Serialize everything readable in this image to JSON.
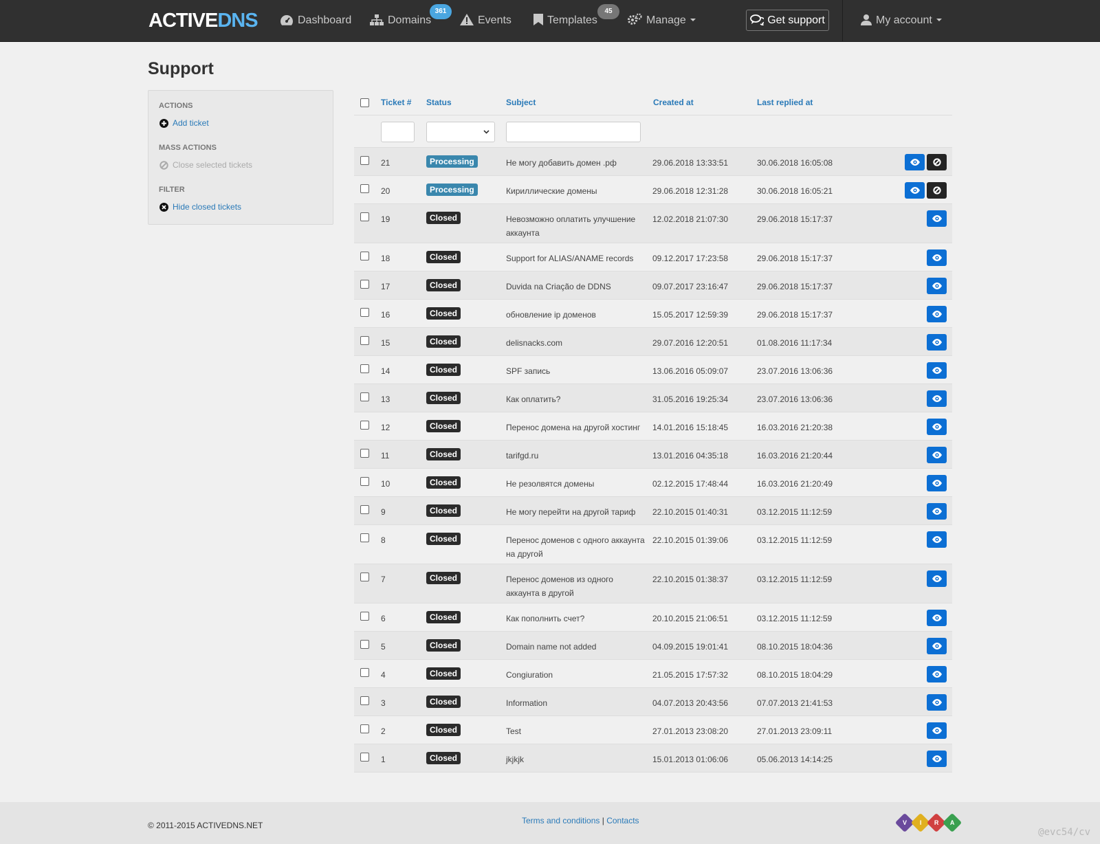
{
  "nav": {
    "brand_part1": "ACTIVE",
    "brand_part2": "DNS",
    "dashboard": "Dashboard",
    "domains": "Domains",
    "domains_count": "361",
    "events": "Events",
    "templates": "Templates",
    "templates_count": "45",
    "manage": "Manage",
    "get_support": "Get support",
    "my_account": "My account",
    "colors": {
      "bar": "#303030",
      "brand_accent": "#5ab4f0",
      "domains_badge": "#4aa6e0",
      "templates_badge": "#777777"
    }
  },
  "page": {
    "title": "Support"
  },
  "sidebar": {
    "actions_heading": "ACTIONS",
    "add_ticket": "Add ticket",
    "mass_actions_heading": "MASS ACTIONS",
    "close_selected": "Close selected tickets",
    "filter_heading": "FILTER",
    "hide_closed": "Hide closed tickets"
  },
  "table": {
    "headers": {
      "ticket": "Ticket #",
      "status": "Status",
      "subject": "Subject",
      "created": "Created at",
      "replied": "Last replied at"
    },
    "status_colors": {
      "Processing": "#3a87ad",
      "Closed": "#2b2b2b"
    },
    "rows": [
      {
        "id": "21",
        "status": "Processing",
        "subject": "Не могу добавить домен .рф",
        "created": "29.06.2018 13:33:51",
        "replied": "30.06.2018 16:05:08",
        "can_close": true
      },
      {
        "id": "20",
        "status": "Processing",
        "subject": "Кириллические домены",
        "created": "29.06.2018 12:31:28",
        "replied": "30.06.2018 16:05:21",
        "can_close": true
      },
      {
        "id": "19",
        "status": "Closed",
        "subject": "Невозможно оплатить улучшение аккаунта",
        "created": "12.02.2018 21:07:30",
        "replied": "29.06.2018 15:17:37",
        "can_close": false,
        "tall": true
      },
      {
        "id": "18",
        "status": "Closed",
        "subject": "Support for ALIAS/ANAME records",
        "created": "09.12.2017 17:23:58",
        "replied": "29.06.2018 15:17:37",
        "can_close": false
      },
      {
        "id": "17",
        "status": "Closed",
        "subject": "Duvida na Criação de DDNS",
        "created": "09.07.2017 23:16:47",
        "replied": "29.06.2018 15:17:37",
        "can_close": false
      },
      {
        "id": "16",
        "status": "Closed",
        "subject": "обновление ip доменов",
        "created": "15.05.2017 12:59:39",
        "replied": "29.06.2018 15:17:37",
        "can_close": false
      },
      {
        "id": "15",
        "status": "Closed",
        "subject": "delisnacks.com",
        "created": "29.07.2016 12:20:51",
        "replied": "01.08.2016 11:17:34",
        "can_close": false
      },
      {
        "id": "14",
        "status": "Closed",
        "subject": "SPF запись",
        "created": "13.06.2016 05:09:07",
        "replied": "23.07.2016 13:06:36",
        "can_close": false
      },
      {
        "id": "13",
        "status": "Closed",
        "subject": "Как оплатить?",
        "created": "31.05.2016 19:25:34",
        "replied": "23.07.2016 13:06:36",
        "can_close": false
      },
      {
        "id": "12",
        "status": "Closed",
        "subject": "Перенос домена на другой хостинг",
        "created": "14.01.2016 15:18:45",
        "replied": "16.03.2016 21:20:38",
        "can_close": false
      },
      {
        "id": "11",
        "status": "Closed",
        "subject": "tarifgd.ru",
        "created": "13.01.2016 04:35:18",
        "replied": "16.03.2016 21:20:44",
        "can_close": false
      },
      {
        "id": "10",
        "status": "Closed",
        "subject": "Не резолвятся домены",
        "created": "02.12.2015 17:48:44",
        "replied": "16.03.2016 21:20:49",
        "can_close": false
      },
      {
        "id": "9",
        "status": "Closed",
        "subject": "Не могу перейти на другой тариф",
        "created": "22.10.2015 01:40:31",
        "replied": "03.12.2015 11:12:59",
        "can_close": false
      },
      {
        "id": "8",
        "status": "Closed",
        "subject": "Перенос доменов с одного аккаунта на другой",
        "created": "22.10.2015 01:39:06",
        "replied": "03.12.2015 11:12:59",
        "can_close": false,
        "tall": true
      },
      {
        "id": "7",
        "status": "Closed",
        "subject": "Перенос доменов из одного аккаунта в другой",
        "created": "22.10.2015 01:38:37",
        "replied": "03.12.2015 11:12:59",
        "can_close": false,
        "tall": true
      },
      {
        "id": "6",
        "status": "Closed",
        "subject": "Как пополнить счет?",
        "created": "20.10.2015 21:06:51",
        "replied": "03.12.2015 11:12:59",
        "can_close": false
      },
      {
        "id": "5",
        "status": "Closed",
        "subject": "Domain name not added",
        "created": "04.09.2015 19:01:41",
        "replied": "08.10.2015 18:04:36",
        "can_close": false
      },
      {
        "id": "4",
        "status": "Closed",
        "subject": "Congiuration",
        "created": "21.05.2015 17:57:32",
        "replied": "08.10.2015 18:04:29",
        "can_close": false
      },
      {
        "id": "3",
        "status": "Closed",
        "subject": "Information",
        "created": "04.07.2013 20:43:56",
        "replied": "07.07.2013 21:41:53",
        "can_close": false
      },
      {
        "id": "2",
        "status": "Closed",
        "subject": "Test",
        "created": "27.01.2013 23:08:20",
        "replied": "27.01.2013 23:09:11",
        "can_close": false
      },
      {
        "id": "1",
        "status": "Closed",
        "subject": "jkjkjk",
        "created": "15.01.2013 01:06:06",
        "replied": "05.06.2013 14:14:25",
        "can_close": false
      }
    ]
  },
  "footer": {
    "copyright": "© 2011-2015 ACTIVEDNS.NET",
    "terms": "Terms and conditions",
    "separator": "|",
    "contacts": "Contacts",
    "vira_letters": [
      "V",
      "I",
      "R",
      "A"
    ],
    "vira_colors": [
      "#6a4a9c",
      "#e0b020",
      "#d04040",
      "#3aa050"
    ],
    "watermark": "@evc54/cv"
  }
}
